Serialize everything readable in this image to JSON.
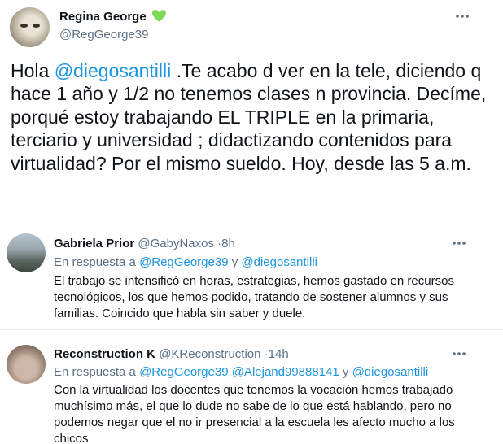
{
  "main_tweet": {
    "name": "Regina George",
    "handle": "@RegGeorge39",
    "text_parts": {
      "p1": "Hola ",
      "mention": "@diegosantilli",
      "p2": " .Te acabo d ver en la tele, diciendo q hace 1 año y 1/2  no tenemos clases n provincia. Decíme, porqué estoy trabajando EL TRIPLE en la primaria, terciario y universidad ; didactizando contenidos para virtualidad? Por el mismo sueldo. Hoy, desde las 5 a.m."
    },
    "verified_icon": "green-heart-icon",
    "more_icon": "more-options-icon"
  },
  "replies": [
    {
      "name": "Gabriela Prior",
      "handle": "@GabyNaxos",
      "separator": "·",
      "time": "8h",
      "reply_prefix": "En respuesta a",
      "mentions": [
        "@RegGeorge39",
        "@diegosantilli"
      ],
      "joiner": "y",
      "text": "El trabajo se intensificó  en horas, estrategias, hemos gastado en recursos tecnológicos, los que hemos podido, tratando de sostener alumnos y sus familias. Coincido que habla sin saber y duele."
    },
    {
      "name": "Reconstruction K",
      "handle": "@KReconstruction",
      "separator": "·",
      "time": "14h",
      "reply_prefix": "En respuesta a",
      "mentions": [
        "@RegGeorge39",
        "@Alejand99888141",
        "@diegosantilli"
      ],
      "joiner": "y",
      "text": "Con la virtualidad los docentes que tenemos la vocación hemos trabajado muchísimo más, el que lo dude no sabe de lo que está hablando, pero no podemos negar que el no ir presencial a la escuela les afecto mucho a los chicos"
    }
  ],
  "colors": {
    "link": "#1b95e0",
    "muted": "#5b7083",
    "text": "#0f1419",
    "divider": "#e6ecf0",
    "heart": "#7ed957"
  }
}
